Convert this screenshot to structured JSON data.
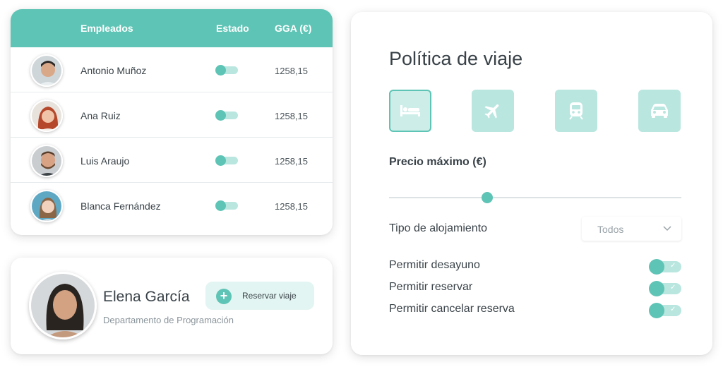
{
  "employees_table": {
    "headers": {
      "employees": "Empleados",
      "status": "Estado",
      "gga": "GGA (€)"
    },
    "rows": [
      {
        "name": "Antonio Muñoz",
        "gga": "1258,15",
        "status_on": false
      },
      {
        "name": "Ana Ruiz",
        "gga": "1258,15",
        "status_on": false
      },
      {
        "name": "Luis Araujo",
        "gga": "1258,15",
        "status_on": false
      },
      {
        "name": "Blanca Fernández",
        "gga": "1258,15",
        "status_on": false
      }
    ]
  },
  "profile": {
    "name": "Elena García",
    "department": "Departamento de Programación",
    "reserve_button": "Reservar viaje",
    "reserve_icon": "plus-icon"
  },
  "policy": {
    "title": "Política de viaje",
    "categories": [
      {
        "icon": "bed-icon",
        "selected": true
      },
      {
        "icon": "plane-icon",
        "selected": false
      },
      {
        "icon": "train-icon",
        "selected": false
      },
      {
        "icon": "car-icon",
        "selected": false
      }
    ],
    "max_price_label": "Precio máximo (€)",
    "max_price_slider_fraction": 0.33,
    "accommodation_label": "Tipo de alojamiento",
    "accommodation_value": "Todos",
    "options": [
      {
        "label": "Permitir desayuno",
        "enabled": true
      },
      {
        "label": "Permitir reservar",
        "enabled": true
      },
      {
        "label": "Permitir cancelar reserva",
        "enabled": true
      }
    ]
  },
  "colors": {
    "accent": "#5ec4b5",
    "accent_light": "#b9e6df",
    "button_bg": "#e3f5f2",
    "text": "#394248"
  }
}
